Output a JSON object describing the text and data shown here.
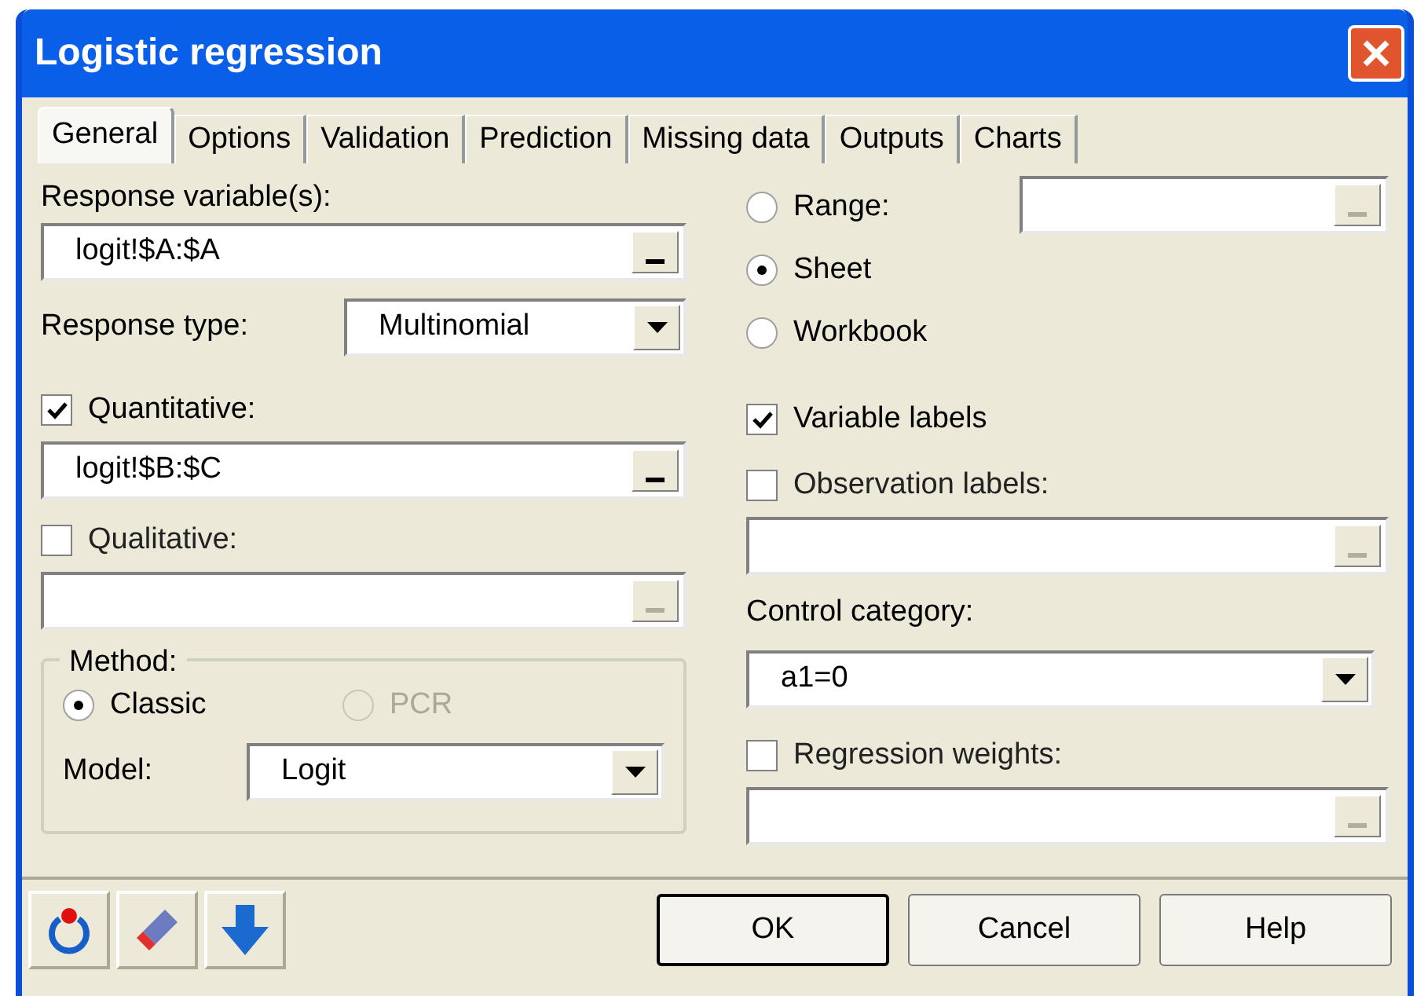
{
  "window": {
    "title": "Logistic regression"
  },
  "tabs": [
    {
      "label": "General",
      "selected": true
    },
    {
      "label": "Options",
      "selected": false
    },
    {
      "label": "Validation",
      "selected": false
    },
    {
      "label": "Prediction",
      "selected": false
    },
    {
      "label": "Missing data",
      "selected": false
    },
    {
      "label": "Outputs",
      "selected": false
    },
    {
      "label": "Charts",
      "selected": false
    }
  ],
  "response_variables": {
    "label": "Response variable(s):",
    "value": "logit!$A:$A",
    "disabled": false
  },
  "response_type": {
    "label": "Response type:",
    "value": "Multinomial"
  },
  "quantitative": {
    "label": "Quantitative:",
    "checked": true,
    "value": "logit!$B:$C",
    "disabled": false
  },
  "qualitative": {
    "label": "Qualitative:",
    "checked": false,
    "disabled": true
  },
  "method": {
    "legend": "Method:",
    "options": [
      {
        "label": "Classic",
        "selected": true,
        "disabled": false
      },
      {
        "label": "PCR",
        "selected": false,
        "disabled": true
      }
    ],
    "model_label": "Model:",
    "model_value": "Logit"
  },
  "output_scope": [
    {
      "label": "Range:",
      "selected": false
    },
    {
      "label": "Sheet",
      "selected": true
    },
    {
      "label": "Workbook",
      "selected": false
    }
  ],
  "range_field": {
    "disabled": true
  },
  "variable_labels": {
    "label": "Variable labels",
    "checked": true
  },
  "observation_labels": {
    "label": "Observation labels:",
    "checked": false,
    "disabled": true
  },
  "control_category": {
    "label": "Control category:",
    "value": "a1=0"
  },
  "regression_weights": {
    "label": "Regression weights:",
    "checked": false,
    "disabled": true
  },
  "buttons": [
    "OK",
    "Cancel",
    "Help"
  ]
}
